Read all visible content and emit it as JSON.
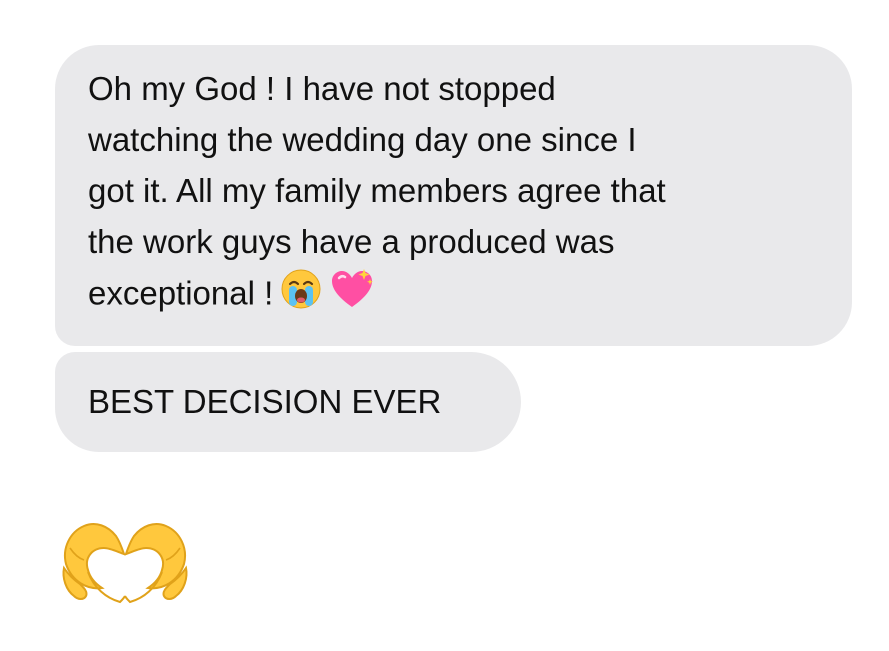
{
  "messages": [
    {
      "lines": [
        "Oh my God ! I have not stopped",
        "watching the wedding day one since I",
        "got it. All my family members agree that",
        "the work guys have a produced was",
        "exceptional !"
      ],
      "trailing_icons": [
        "loudly-crying-face-icon",
        "sparkling-heart-icon"
      ]
    },
    {
      "text": "BEST DECISION EVER"
    }
  ],
  "reaction_icon": "heart-hands-icon",
  "colors": {
    "bubble_background": "#e9e9eb",
    "text": "#111111",
    "emoji_yellow": "#ffc83d",
    "emoji_pink": "#ff4fa3"
  }
}
